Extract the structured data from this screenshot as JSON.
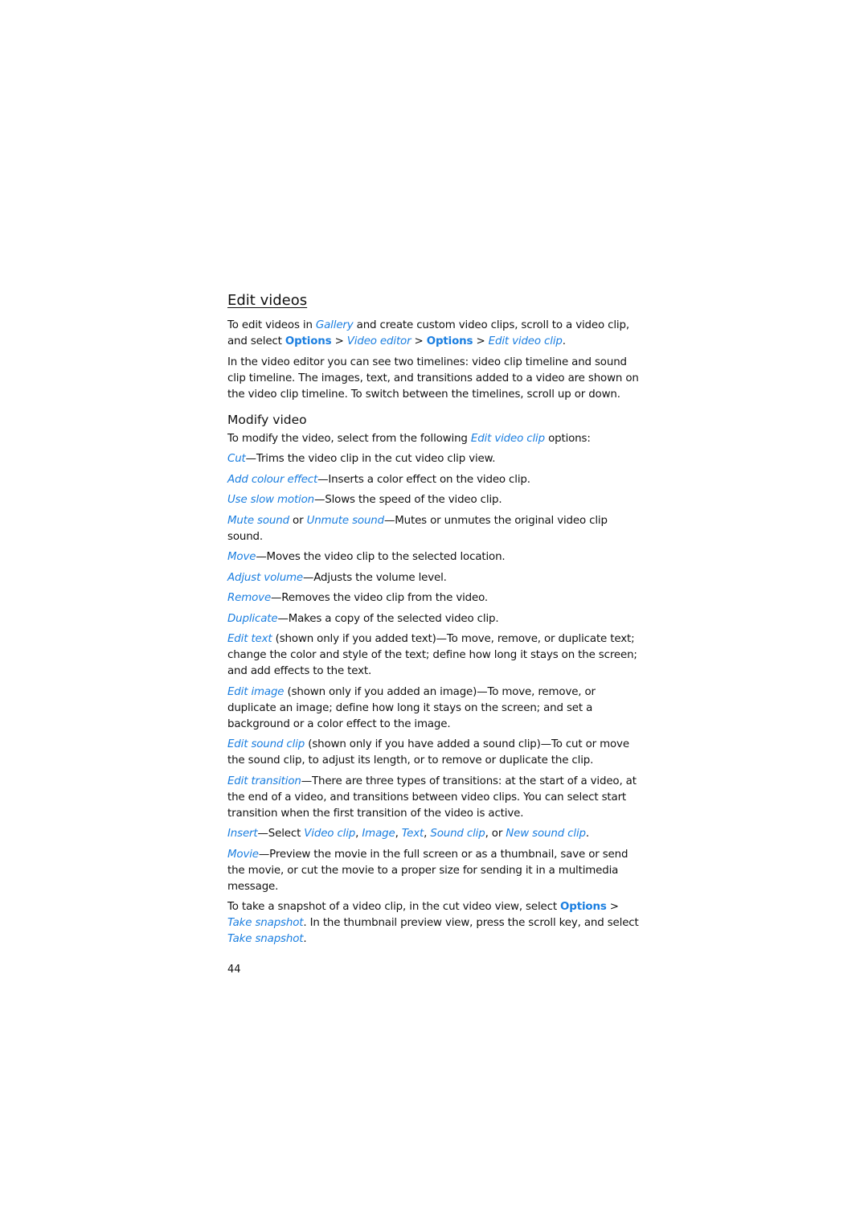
{
  "section": {
    "title": "Edit videos",
    "intro": {
      "t1": "To edit videos in ",
      "gallery": "Gallery",
      "t2": " and create custom video clips, scroll to a video clip, and select ",
      "options1": "Options",
      "sep1": " > ",
      "video_editor": "Video editor",
      "sep2": " > ",
      "options2": "Options",
      "sep3": " > ",
      "edit_video_clip": "Edit video clip",
      "end": "."
    },
    "timelines": "In the video editor you can see two timelines: video clip timeline and sound clip timeline. The images, text, and transitions added to a video are shown on the video clip timeline. To switch between the timelines, scroll up or down."
  },
  "modify": {
    "title": "Modify video",
    "intro_t1": "To modify the video, select from the following ",
    "intro_link": "Edit video clip",
    "intro_t2": " options:",
    "items": [
      {
        "link": "Cut",
        "text": "—Trims the video clip in the cut video clip view."
      },
      {
        "link": "Add colour effect",
        "text": "—Inserts a color effect on the video clip."
      },
      {
        "link": "Use slow motion",
        "text": "—Slows the speed of the video clip."
      },
      {
        "link": "Mute sound",
        "mid": " or ",
        "link2": "Unmute sound",
        "text": "—Mutes or unmutes the original video clip sound."
      },
      {
        "link": "Move",
        "text": "—Moves the video clip to the selected location."
      },
      {
        "link": "Adjust volume",
        "text": "—Adjusts the volume level."
      },
      {
        "link": "Remove",
        "text": "—Removes the video clip from the video."
      },
      {
        "link": "Duplicate",
        "text": "—Makes a copy of the selected video clip."
      },
      {
        "link": "Edit text",
        "text": " (shown only if you added text)—To move, remove, or duplicate text; change the color and style of the text; define how long it stays on the screen; and add effects to the text."
      },
      {
        "link": "Edit image",
        "text": " (shown only if you added an image)—To move, remove, or duplicate an image; define how long it stays on the screen; and set a background or a color effect to the image."
      },
      {
        "link": "Edit sound clip",
        "text": " (shown only if you have added a sound clip)—To cut or move the sound clip, to adjust its length, or to remove or duplicate the clip."
      },
      {
        "link": "Edit transition",
        "text": "—There are three types of transitions: at the start of a video, at the end of a video, and transitions between video clips. You can select start transition when the first transition of the video is active."
      }
    ],
    "insert": {
      "link": "Insert",
      "t1": "—Select ",
      "o1": "Video clip",
      "c1": ", ",
      "o2": "Image",
      "c2": ", ",
      "o3": "Text",
      "c3": ", ",
      "o4": "Sound clip",
      "c4": ", or ",
      "o5": "New sound clip",
      "end": "."
    },
    "movie": {
      "link": "Movie",
      "text": "—Preview the movie in the full screen or as a thumbnail, save or send the movie, or cut the movie to a proper size for sending it in a multimedia message."
    },
    "snapshot": {
      "t1": "To take a snapshot of a video clip, in the cut video view, select ",
      "options": "Options",
      "sep": " > ",
      "take1": "Take snapshot",
      "t2": ". In the thumbnail preview view, press the scroll key, and select ",
      "take2": "Take snapshot",
      "end": "."
    }
  },
  "page_number": "44",
  "colors": {
    "link": "#1a7ee0",
    "text": "#111111"
  }
}
